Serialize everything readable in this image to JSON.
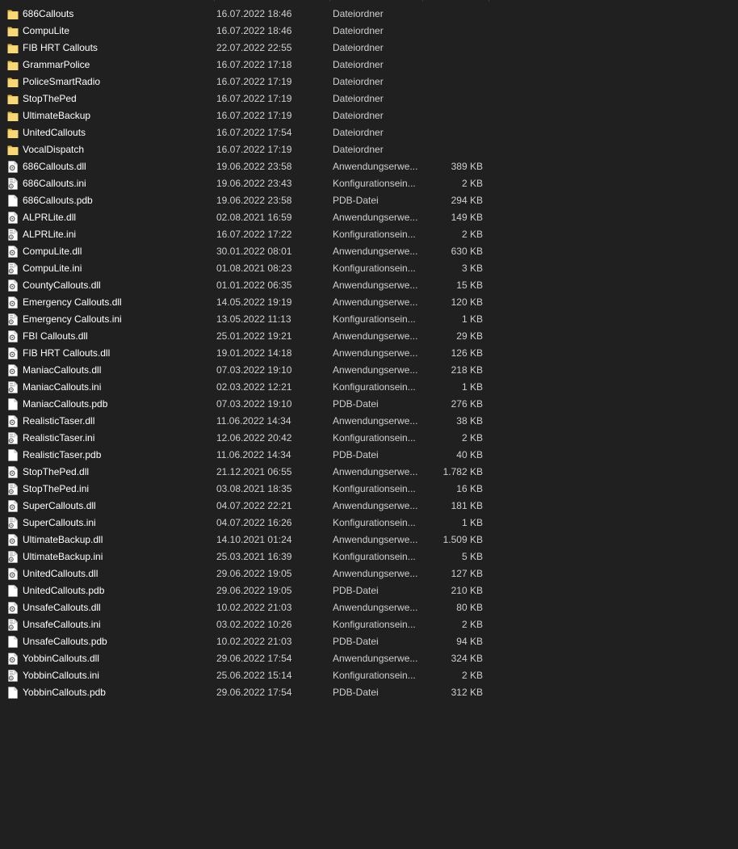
{
  "colors": {
    "background": "#202020",
    "folder": "#f8d775",
    "folder_dark": "#e0b441",
    "file": "#ffffff",
    "text": "#ffffff",
    "text_secondary": "#cfcfcf"
  },
  "files": [
    {
      "name": "686Callouts",
      "date": "16.07.2022 18:46",
      "type": "Dateiordner",
      "size": "",
      "icon": "folder-icon"
    },
    {
      "name": "CompuLite",
      "date": "16.07.2022 18:46",
      "type": "Dateiordner",
      "size": "",
      "icon": "folder-icon"
    },
    {
      "name": "FIB HRT Callouts",
      "date": "22.07.2022 22:55",
      "type": "Dateiordner",
      "size": "",
      "icon": "folder-icon"
    },
    {
      "name": "GrammarPolice",
      "date": "16.07.2022 17:18",
      "type": "Dateiordner",
      "size": "",
      "icon": "folder-icon"
    },
    {
      "name": "PoliceSmartRadio",
      "date": "16.07.2022 17:19",
      "type": "Dateiordner",
      "size": "",
      "icon": "folder-icon"
    },
    {
      "name": "StopThePed",
      "date": "16.07.2022 17:19",
      "type": "Dateiordner",
      "size": "",
      "icon": "folder-icon"
    },
    {
      "name": "UltimateBackup",
      "date": "16.07.2022 17:19",
      "type": "Dateiordner",
      "size": "",
      "icon": "folder-icon"
    },
    {
      "name": "UnitedCallouts",
      "date": "16.07.2022 17:54",
      "type": "Dateiordner",
      "size": "",
      "icon": "folder-icon"
    },
    {
      "name": "VocalDispatch",
      "date": "16.07.2022 17:19",
      "type": "Dateiordner",
      "size": "",
      "icon": "folder-icon"
    },
    {
      "name": "686Callouts.dll",
      "date": "19.06.2022 23:58",
      "type": "Anwendungserwe...",
      "size": "389 KB",
      "icon": "dll-file-icon"
    },
    {
      "name": "686Callouts.ini",
      "date": "19.06.2022 23:43",
      "type": "Konfigurationsein...",
      "size": "2 KB",
      "icon": "ini-file-icon"
    },
    {
      "name": "686Callouts.pdb",
      "date": "19.06.2022 23:58",
      "type": "PDB-Datei",
      "size": "294 KB",
      "icon": "pdb-file-icon"
    },
    {
      "name": "ALPRLite.dll",
      "date": "02.08.2021 16:59",
      "type": "Anwendungserwe...",
      "size": "149 KB",
      "icon": "dll-file-icon"
    },
    {
      "name": "ALPRLite.ini",
      "date": "16.07.2022 17:22",
      "type": "Konfigurationsein...",
      "size": "2 KB",
      "icon": "ini-file-icon"
    },
    {
      "name": "CompuLite.dll",
      "date": "30.01.2022 08:01",
      "type": "Anwendungserwe...",
      "size": "630 KB",
      "icon": "dll-file-icon"
    },
    {
      "name": "CompuLite.ini",
      "date": "01.08.2021 08:23",
      "type": "Konfigurationsein...",
      "size": "3 KB",
      "icon": "ini-file-icon"
    },
    {
      "name": "CountyCallouts.dll",
      "date": "01.01.2022 06:35",
      "type": "Anwendungserwe...",
      "size": "15 KB",
      "icon": "dll-file-icon"
    },
    {
      "name": "Emergency Callouts.dll",
      "date": "14.05.2022 19:19",
      "type": "Anwendungserwe...",
      "size": "120 KB",
      "icon": "dll-file-icon"
    },
    {
      "name": "Emergency Callouts.ini",
      "date": "13.05.2022 11:13",
      "type": "Konfigurationsein...",
      "size": "1 KB",
      "icon": "ini-file-icon"
    },
    {
      "name": "FBI Callouts.dll",
      "date": "25.01.2022 19:21",
      "type": "Anwendungserwe...",
      "size": "29 KB",
      "icon": "dll-file-icon"
    },
    {
      "name": "FIB HRT Callouts.dll",
      "date": "19.01.2022 14:18",
      "type": "Anwendungserwe...",
      "size": "126 KB",
      "icon": "dll-file-icon"
    },
    {
      "name": "ManiacCallouts.dll",
      "date": "07.03.2022 19:10",
      "type": "Anwendungserwe...",
      "size": "218 KB",
      "icon": "dll-file-icon"
    },
    {
      "name": "ManiacCallouts.ini",
      "date": "02.03.2022 12:21",
      "type": "Konfigurationsein...",
      "size": "1 KB",
      "icon": "ini-file-icon"
    },
    {
      "name": "ManiacCallouts.pdb",
      "date": "07.03.2022 19:10",
      "type": "PDB-Datei",
      "size": "276 KB",
      "icon": "pdb-file-icon"
    },
    {
      "name": "RealisticTaser.dll",
      "date": "11.06.2022 14:34",
      "type": "Anwendungserwe...",
      "size": "38 KB",
      "icon": "dll-file-icon"
    },
    {
      "name": "RealisticTaser.ini",
      "date": "12.06.2022 20:42",
      "type": "Konfigurationsein...",
      "size": "2 KB",
      "icon": "ini-file-icon"
    },
    {
      "name": "RealisticTaser.pdb",
      "date": "11.06.2022 14:34",
      "type": "PDB-Datei",
      "size": "40 KB",
      "icon": "pdb-file-icon"
    },
    {
      "name": "StopThePed.dll",
      "date": "21.12.2021 06:55",
      "type": "Anwendungserwe...",
      "size": "1.782 KB",
      "icon": "dll-file-icon"
    },
    {
      "name": "StopThePed.ini",
      "date": "03.08.2021 18:35",
      "type": "Konfigurationsein...",
      "size": "16 KB",
      "icon": "ini-file-icon"
    },
    {
      "name": "SuperCallouts.dll",
      "date": "04.07.2022 22:21",
      "type": "Anwendungserwe...",
      "size": "181 KB",
      "icon": "dll-file-icon"
    },
    {
      "name": "SuperCallouts.ini",
      "date": "04.07.2022 16:26",
      "type": "Konfigurationsein...",
      "size": "1 KB",
      "icon": "ini-file-icon"
    },
    {
      "name": "UltimateBackup.dll",
      "date": "14.10.2021 01:24",
      "type": "Anwendungserwe...",
      "size": "1.509 KB",
      "icon": "dll-file-icon"
    },
    {
      "name": "UltimateBackup.ini",
      "date": "25.03.2021 16:39",
      "type": "Konfigurationsein...",
      "size": "5 KB",
      "icon": "ini-file-icon"
    },
    {
      "name": "UnitedCallouts.dll",
      "date": "29.06.2022 19:05",
      "type": "Anwendungserwe...",
      "size": "127 KB",
      "icon": "dll-file-icon"
    },
    {
      "name": "UnitedCallouts.pdb",
      "date": "29.06.2022 19:05",
      "type": "PDB-Datei",
      "size": "210 KB",
      "icon": "pdb-file-icon"
    },
    {
      "name": "UnsafeCallouts.dll",
      "date": "10.02.2022 21:03",
      "type": "Anwendungserwe...",
      "size": "80 KB",
      "icon": "dll-file-icon"
    },
    {
      "name": "UnsafeCallouts.ini",
      "date": "03.02.2022 10:26",
      "type": "Konfigurationsein...",
      "size": "2 KB",
      "icon": "ini-file-icon"
    },
    {
      "name": "UnsafeCallouts.pdb",
      "date": "10.02.2022 21:03",
      "type": "PDB-Datei",
      "size": "94 KB",
      "icon": "pdb-file-icon"
    },
    {
      "name": "YobbinCallouts.dll",
      "date": "29.06.2022 17:54",
      "type": "Anwendungserwe...",
      "size": "324 KB",
      "icon": "dll-file-icon"
    },
    {
      "name": "YobbinCallouts.ini",
      "date": "25.06.2022 15:14",
      "type": "Konfigurationsein...",
      "size": "2 KB",
      "icon": "ini-file-icon"
    },
    {
      "name": "YobbinCallouts.pdb",
      "date": "29.06.2022 17:54",
      "type": "PDB-Datei",
      "size": "312 KB",
      "icon": "pdb-file-icon"
    }
  ]
}
